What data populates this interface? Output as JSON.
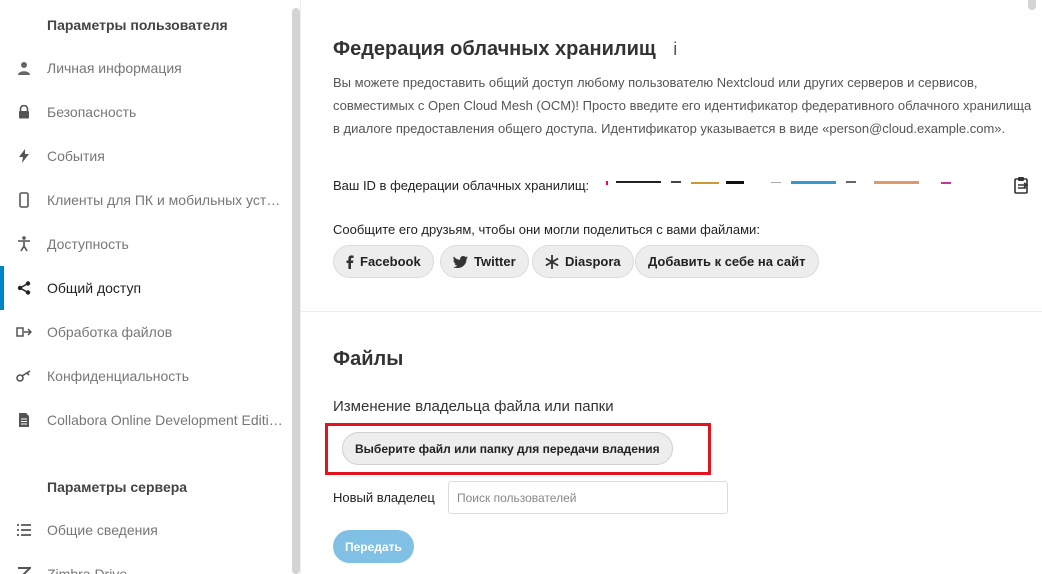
{
  "sidebar": {
    "user_heading": "Параметры пользователя",
    "server_heading": "Параметры сервера",
    "items": [
      {
        "label": "Личная информация",
        "icon": "user-icon"
      },
      {
        "label": "Безопасность",
        "icon": "lock-icon"
      },
      {
        "label": "События",
        "icon": "lightning-icon"
      },
      {
        "label": "Клиенты для ПК и мобильных устройств",
        "icon": "phone-icon"
      },
      {
        "label": "Доступность",
        "icon": "accessibility-icon"
      },
      {
        "label": "Общий доступ",
        "icon": "share-icon",
        "active": true
      },
      {
        "label": "Обработка файлов",
        "icon": "workflow-icon"
      },
      {
        "label": "Конфиденциальность",
        "icon": "key-icon"
      },
      {
        "label": "Collabora Online Development Edition",
        "icon": "document-icon"
      }
    ],
    "server_items": [
      {
        "label": "Общие сведения",
        "icon": "list-icon"
      },
      {
        "label": "Zimbra Drive",
        "icon": "zimbra-icon"
      }
    ]
  },
  "federation": {
    "title": "Федерация облачных хранилищ",
    "info_icon": "info-icon",
    "description": "Вы можете предоставить общий доступ любому пользователю Nextcloud или других серверов и сервисов, совместимых с Open Cloud Mesh (OCM)! Просто введите его идентификатор федеративного облачного хранилища в диалоге предоставления общего доступа. Идентификатор указывается в виде «person@cloud.example.com».",
    "id_label": "Ваш ID в федерации облачных хранилищ:",
    "share_prompt": "Сообщите его друзьям, чтобы они могли поделиться с вами файлами:",
    "buttons": {
      "facebook": "Facebook",
      "twitter": "Twitter",
      "diaspora": "Diaspora",
      "add_to_site": "Добавить к себе на сайт"
    }
  },
  "files": {
    "title": "Файлы",
    "ownership_label": "Изменение владельца файла или папки",
    "choose_button": "Выберите файл или папку для передачи владения",
    "new_owner_label": "Новый владелец",
    "search_placeholder": "Поиск пользователей",
    "transfer_button": "Передать"
  },
  "colors": {
    "accent": "#0082c9",
    "highlight": "#e5131d",
    "transfer_disabled": "#7fc0e4"
  }
}
